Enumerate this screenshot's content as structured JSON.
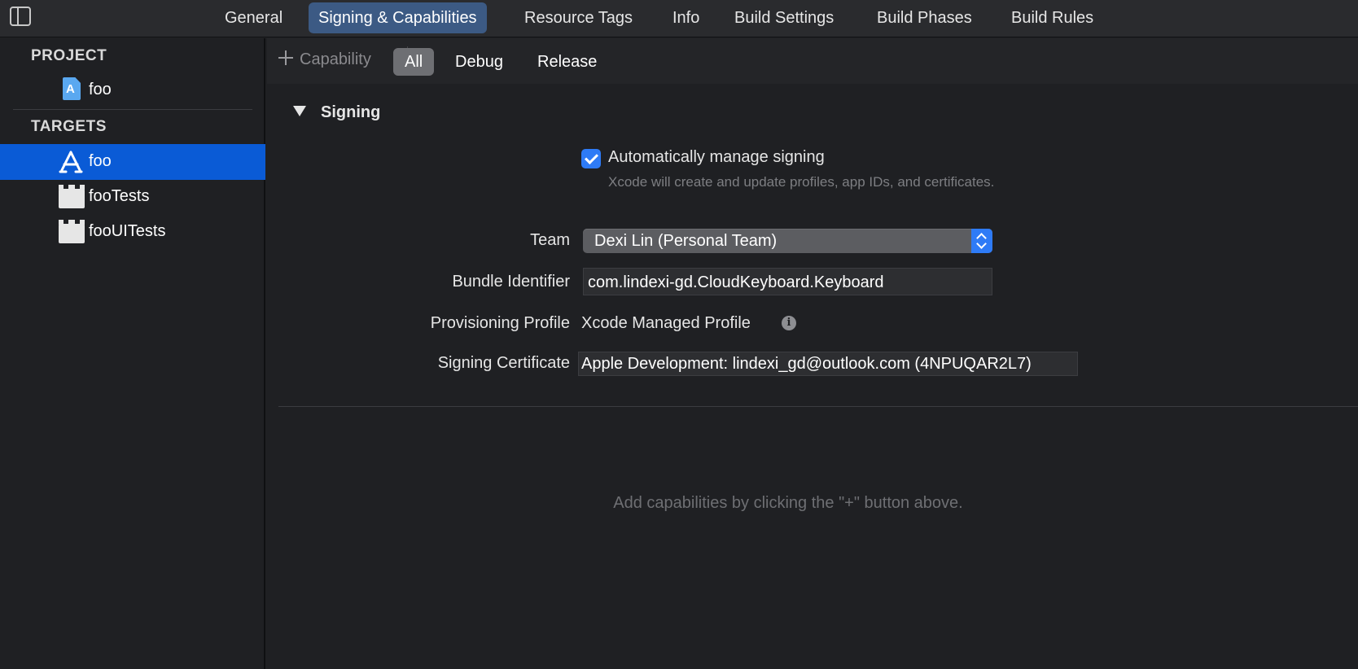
{
  "topbar": {
    "tabs": [
      {
        "label": "General"
      },
      {
        "label": "Signing & Capabilities"
      },
      {
        "label": "Resource Tags"
      },
      {
        "label": "Info"
      },
      {
        "label": "Build Settings"
      },
      {
        "label": "Build Phases"
      },
      {
        "label": "Build Rules"
      }
    ],
    "active_tab": "Signing & Capabilities"
  },
  "sidebar": {
    "project_header": "PROJECT",
    "project_item": "foo",
    "targets_header": "TARGETS",
    "targets": [
      {
        "label": "foo",
        "icon": "app-target-icon",
        "selected": true
      },
      {
        "label": "fooTests",
        "icon": "test-bundle-icon",
        "selected": false
      },
      {
        "label": "fooUITests",
        "icon": "test-bundle-icon",
        "selected": false
      }
    ]
  },
  "subbar": {
    "capability_label": "Capability",
    "filters": [
      {
        "label": "All",
        "active": true
      },
      {
        "label": "Debug",
        "active": false
      },
      {
        "label": "Release",
        "active": false
      }
    ]
  },
  "signing": {
    "section_title": "Signing",
    "auto_manage_label": "Automatically manage signing",
    "auto_manage_checked": true,
    "auto_manage_desc": "Xcode will create and update profiles, app IDs, and certificates.",
    "team_label": "Team",
    "team_value": "Dexi Lin (Personal Team)",
    "bundle_id_label": "Bundle Identifier",
    "bundle_id_value": "com.lindexi-gd.CloudKeyboard.Keyboard",
    "profile_label": "Provisioning Profile",
    "profile_value": "Xcode Managed Profile",
    "info_glyph": "i",
    "certificate_label": "Signing Certificate",
    "certificate_value": "Apple Development: lindexi_gd@outlook.com (4NPUQAR2L7)"
  },
  "empty_hint": "Add capabilities by clicking the \"+\" button above.",
  "colors": {
    "accent": "#2e7bf6",
    "selection": "#0a5bd6",
    "active_tab": "#3c5a84",
    "background": "#1f2023"
  }
}
